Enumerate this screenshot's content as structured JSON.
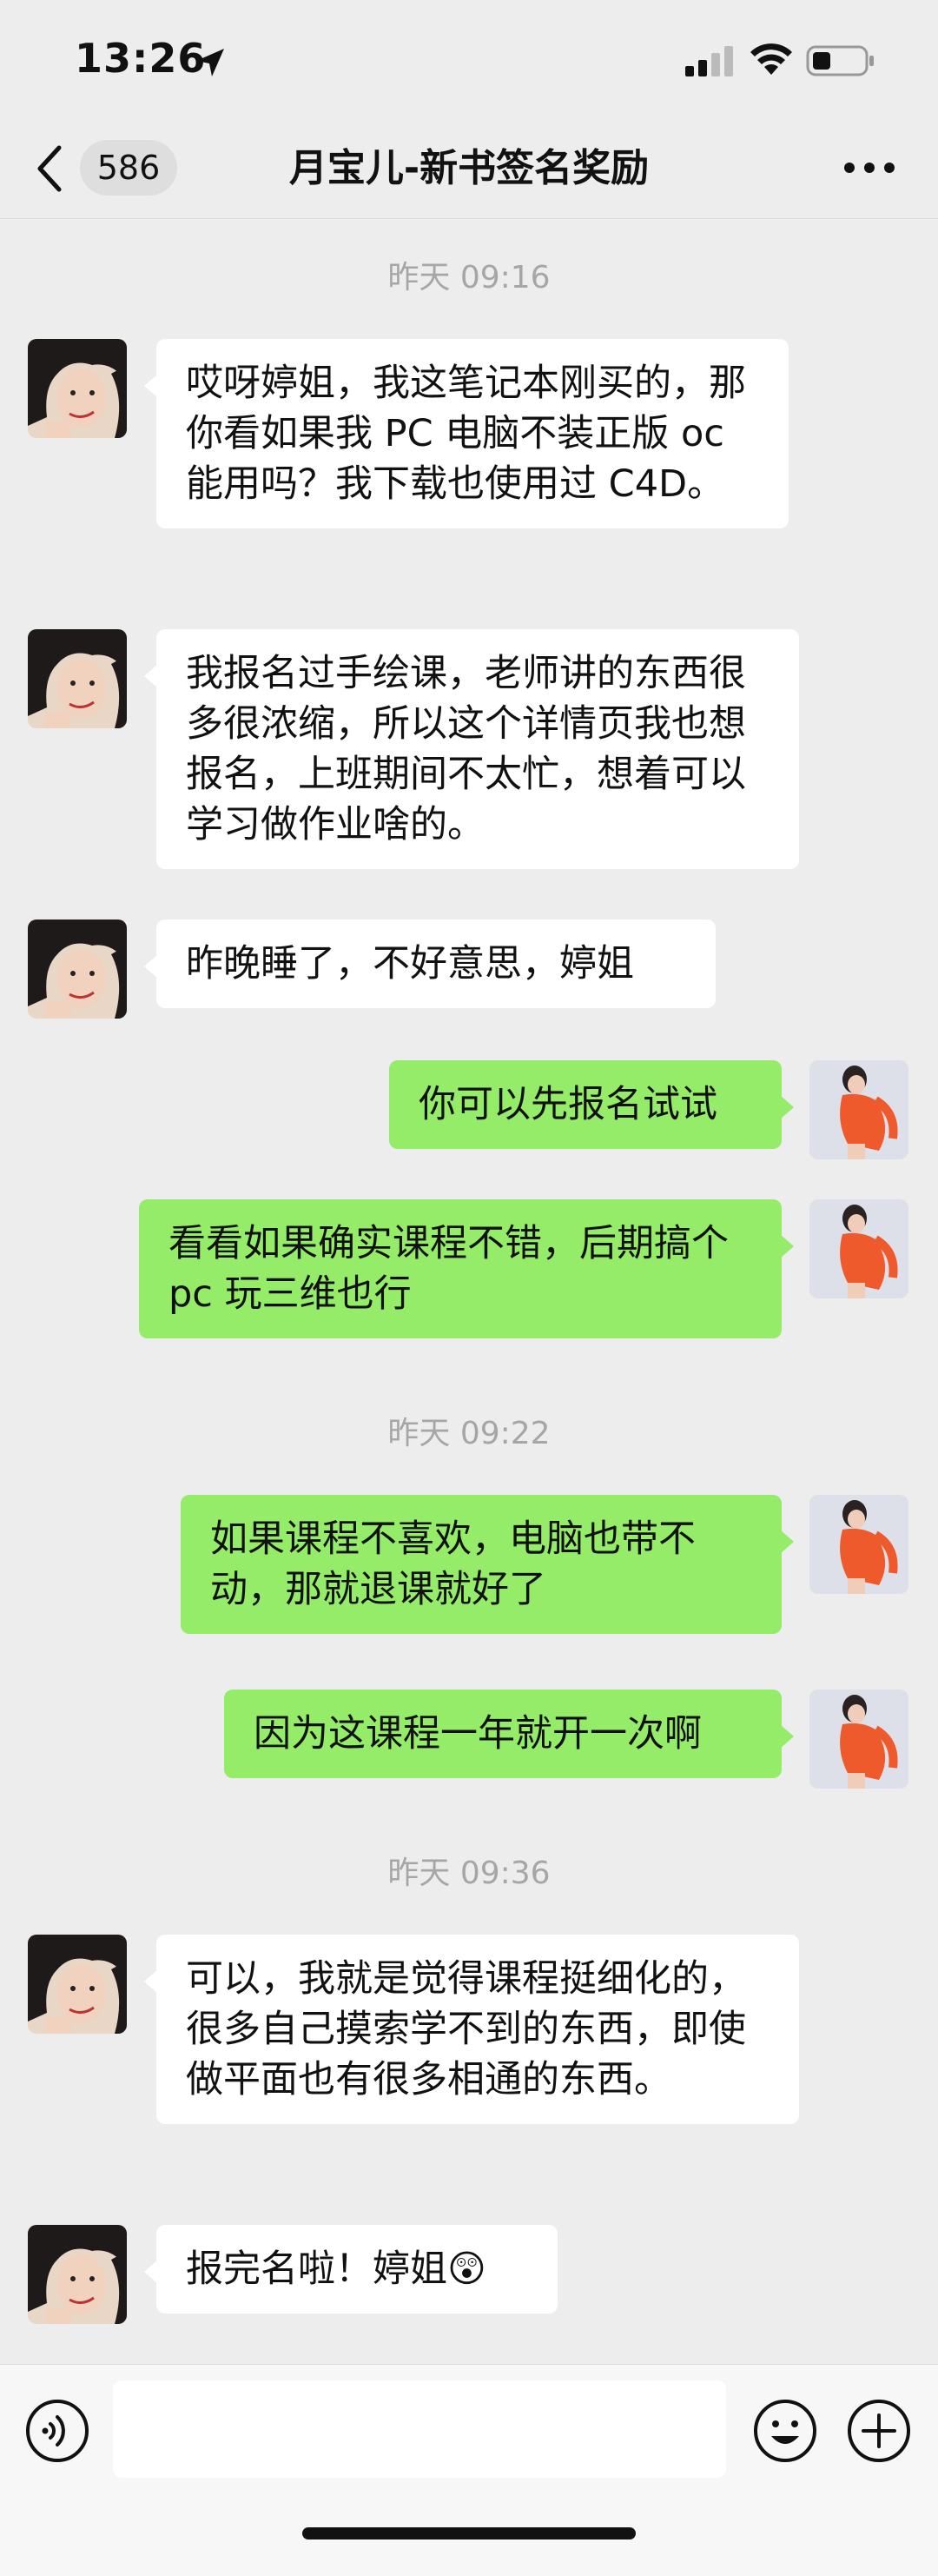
{
  "status_bar": {
    "time": "13:26"
  },
  "nav": {
    "unread_count": "586",
    "title": "月宝儿-新书签名奖励"
  },
  "messages": [
    {
      "type": "time",
      "text": "昨天 09:16"
    },
    {
      "type": "msg",
      "side": "in",
      "text": "哎呀婷姐，我这笔记本刚买的，那你看如果我 PC 电脑不装正版 oc 能用吗？我下载也使用过 C4D。"
    },
    {
      "type": "msg",
      "side": "in",
      "text": "我报名过手绘课，老师讲的东西很多很浓缩，所以这个详情页我也想报名，上班期间不太忙，想着可以学习做作业啥的。"
    },
    {
      "type": "msg",
      "side": "in",
      "text": "昨晚睡了，不好意思，婷姐"
    },
    {
      "type": "msg",
      "side": "out",
      "text": "你可以先报名试试"
    },
    {
      "type": "msg",
      "side": "out",
      "text": "看看如果确实课程不错，后期搞个 pc 玩三维也行"
    },
    {
      "type": "time",
      "text": "昨天 09:22"
    },
    {
      "type": "msg",
      "side": "out",
      "text": "如果课程不喜欢，电脑也带不动，那就退课就好了"
    },
    {
      "type": "msg",
      "side": "out",
      "text": "因为这课程一年就开一次啊"
    },
    {
      "type": "time",
      "text": "昨天 09:36"
    },
    {
      "type": "msg",
      "side": "in",
      "text": "可以，我就是觉得课程挺细化的，很多自己摸索学不到的东西，即使做平面也有很多相通的东西。"
    },
    {
      "type": "msg",
      "side": "in",
      "text": "报完名啦！婷姐😲"
    }
  ],
  "input": {
    "placeholder": ""
  },
  "colors": {
    "bg": "#ededed",
    "bubble_out": "#95ec69",
    "bubble_in": "#ffffff",
    "time_text": "#a6a6a6"
  }
}
